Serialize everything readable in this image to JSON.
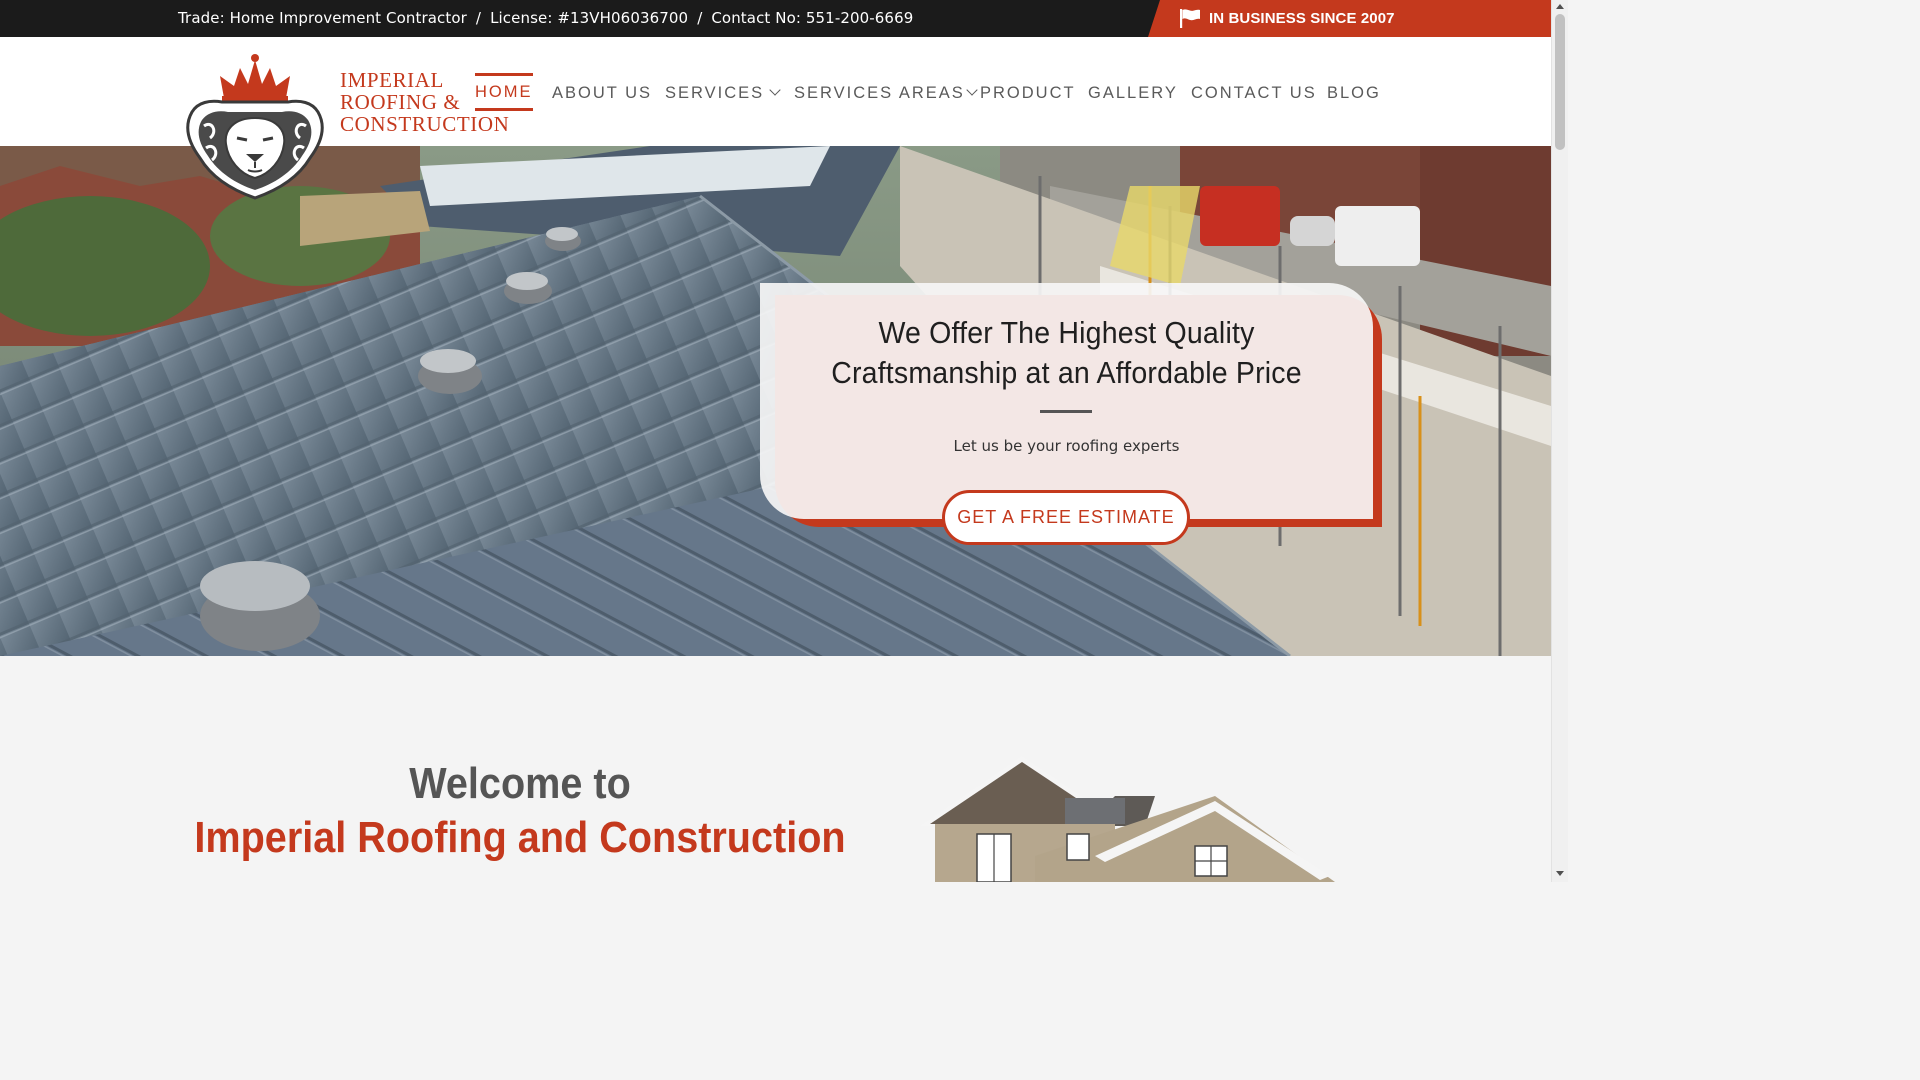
{
  "topbar": {
    "trade": "Trade: Home Improvement Contractor",
    "separator": "/",
    "license": "License: #13VH06036700",
    "contact": "Contact No: 551-200-6669",
    "since_badge": "IN BUSINESS SINCE 2007",
    "since_icon": "flag-icon"
  },
  "logo": {
    "line1": "IMPERIAL",
    "line2": "ROOFING &",
    "line3": "CONSTRUCTION",
    "emblem_icon": "lion-crown-icon"
  },
  "nav": {
    "items": [
      {
        "label": "HOME",
        "active": true
      },
      {
        "label": "ABOUT US"
      },
      {
        "label": "SERVICES",
        "dropdown": true
      },
      {
        "label": "SERVICES AREAS",
        "dropdown": true
      },
      {
        "label": "PRODUCT"
      },
      {
        "label": "GALLERY"
      },
      {
        "label": "CONTACT US"
      },
      {
        "label": "BLOG"
      }
    ]
  },
  "hero": {
    "title_line1": "We Offer The Highest Quality",
    "title_line2": "Craftsmanship at an Affordable Price",
    "subtitle": "Let us be your roofing experts",
    "cta": "GET A FREE ESTIMATE"
  },
  "welcome": {
    "line1": "Welcome to",
    "line2": "Imperial Roofing and Construction"
  },
  "colors": {
    "accent": "#c4391d",
    "topbar": "#1b1b1b",
    "text": "#5a5a5a"
  }
}
